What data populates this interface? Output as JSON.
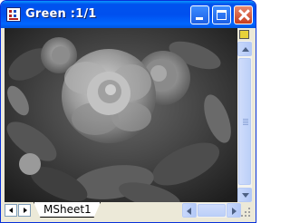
{
  "window": {
    "title": "Green :1/1",
    "app_icon": "worksheet-icon"
  },
  "titlebar_buttons": {
    "minimize_icon": "minimize-icon",
    "maximize_icon": "maximize-icon",
    "close_icon": "close-icon"
  },
  "image": {
    "subject": "grayscale camellia flower photograph"
  },
  "scrollbars": {
    "vertical_up_icon": "arrow-up-icon",
    "vertical_down_icon": "arrow-down-icon",
    "horizontal_left_icon": "arrow-left-icon",
    "horizontal_right_icon": "arrow-right-icon"
  },
  "sheet_tabs": [
    {
      "label": "MSheet1",
      "active": true
    }
  ],
  "colors": {
    "titlebar": "#0054e3",
    "close_button": "#d8532f",
    "window_frame": "#ece9d8"
  }
}
